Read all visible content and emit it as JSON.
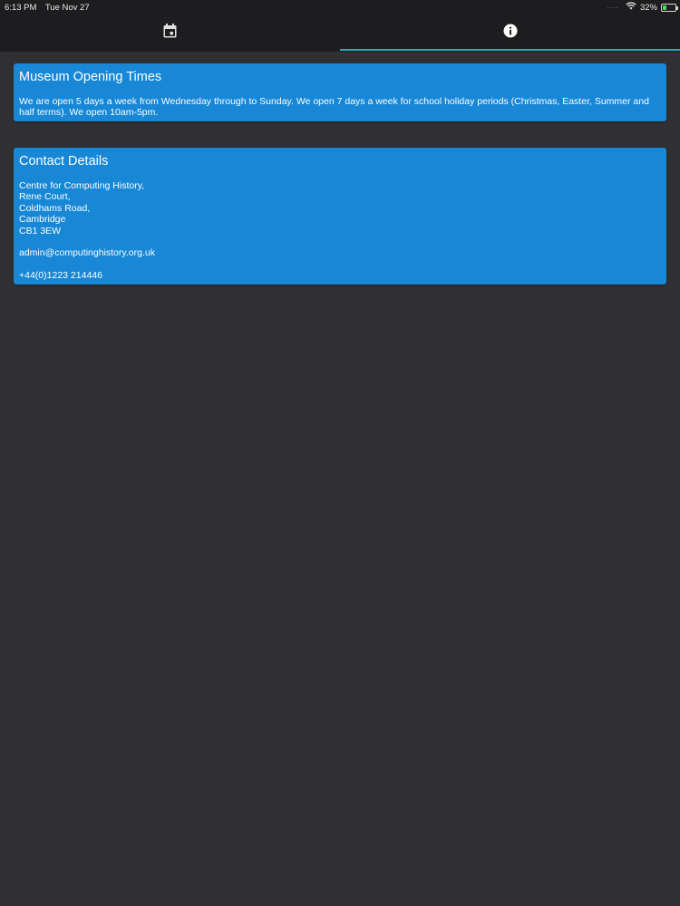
{
  "status_bar": {
    "time": "6:13 PM",
    "date": "Tue Nov 27",
    "battery_percent": "32%",
    "battery_level": 0.32,
    "battery_color": "#4cd964"
  },
  "tabs": [
    {
      "icon": "calendar-icon",
      "active": false
    },
    {
      "icon": "info-icon",
      "active": true
    }
  ],
  "accent_color": "#2fa9b8",
  "card_color": "#1787d6",
  "opening_times": {
    "title": "Museum Opening Times",
    "body": "We are open 5 days a week from Wednesday through to Sunday.  We open 7 days a week for school holiday periods (Christmas, Easter, Summer and half terms).  We open 10am-5pm."
  },
  "contact": {
    "title": "Contact Details",
    "address": [
      "Centre for Computing History,",
      "Rene Court,",
      "Coldhams Road,",
      "Cambridge",
      "CB1 3EW"
    ],
    "email": "admin@computinghistory.org.uk",
    "phone": "+44(0)1223 214446"
  }
}
